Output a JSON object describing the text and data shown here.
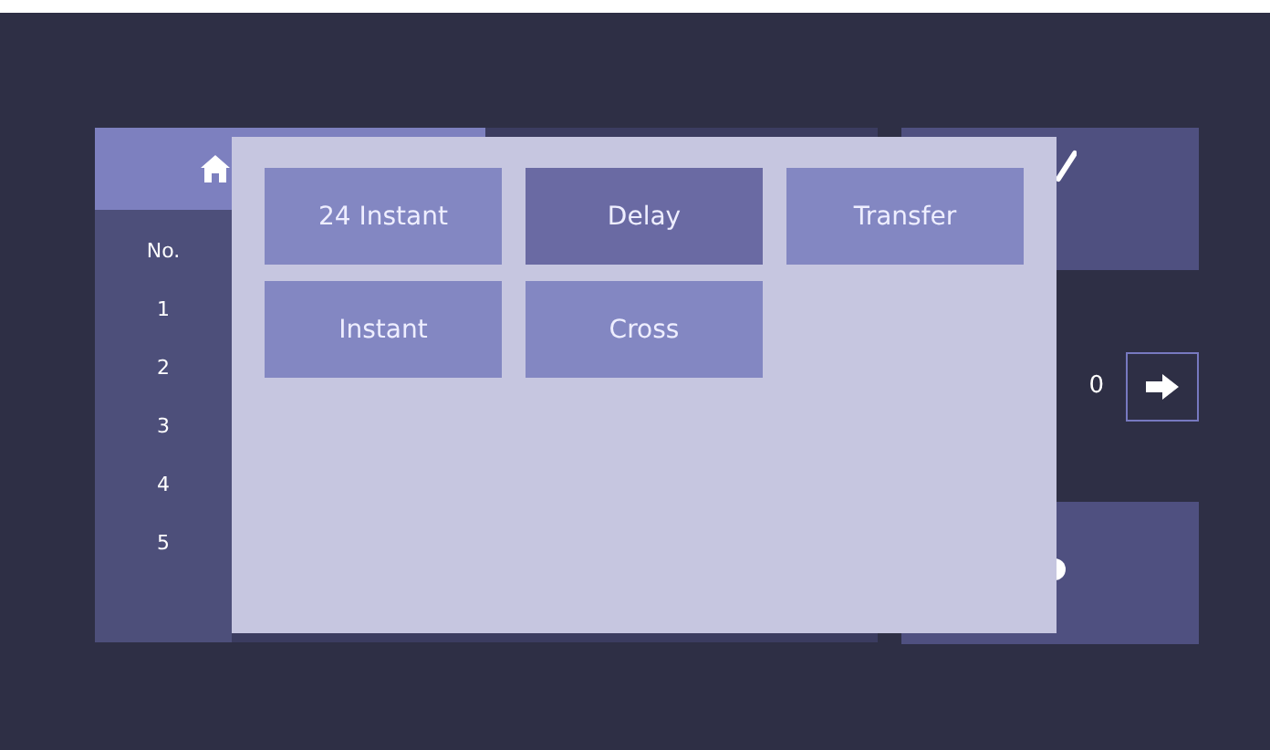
{
  "list": {
    "header": "No.",
    "rows": [
      "1",
      "2",
      "3",
      "4",
      "5"
    ]
  },
  "reading": "0",
  "popup": {
    "options": [
      {
        "label": "24 Instant",
        "selected": false
      },
      {
        "label": "Delay",
        "selected": true
      },
      {
        "label": "Transfer",
        "selected": false
      },
      {
        "label": "Instant",
        "selected": false
      },
      {
        "label": "Cross",
        "selected": false
      }
    ]
  }
}
